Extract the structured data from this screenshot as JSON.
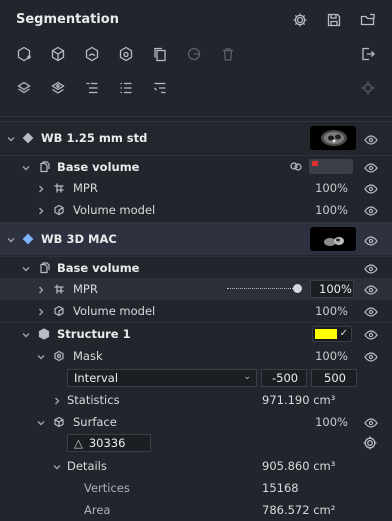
{
  "panel": {
    "title": "Segmentation"
  },
  "colors": {
    "structure_color": "#ffff00",
    "selected_row_bg": "#2d3140",
    "red_marker": "#e03030"
  },
  "header_icons": [
    "gear-icon",
    "save-icon",
    "open-folder-icon"
  ],
  "toolbar": {
    "row1": [
      "add-shape-icon",
      "cube-icon",
      "cube-cut-icon",
      "cube-gear-icon",
      "copy-icon",
      "undo-circle-icon",
      "trash-icon",
      "export-icon"
    ],
    "row2": [
      "layers-stack-icon",
      "layers-alt-icon",
      "indent-list-icon",
      "list-icon",
      "outdent-list-icon",
      "target-icon"
    ]
  },
  "tree": {
    "series1": {
      "label": "WB 1.25 mm std"
    },
    "bv1": {
      "label": "Base volume"
    },
    "mpr1": {
      "label": "MPR",
      "pct": "100%"
    },
    "vm1": {
      "label": "Volume model",
      "pct": "100%"
    },
    "series2": {
      "label": "WB 3D MAC"
    },
    "bv2": {
      "label": "Base volume"
    },
    "mpr2": {
      "label": "MPR",
      "pct": "100%"
    },
    "vm2": {
      "label": "Volume model",
      "pct": "100%"
    },
    "structure": {
      "label": "Structure 1"
    },
    "mask": {
      "label": "Mask",
      "pct": "100%"
    },
    "interval": {
      "mode": "Interval",
      "min": "-500",
      "max": "500"
    },
    "statistics": {
      "label": "Statistics",
      "value": "971.190 cm³"
    },
    "surface": {
      "label": "Surface",
      "pct": "100%",
      "triangles": "30336"
    },
    "details": {
      "label": "Details",
      "value": "905.860 cm³"
    },
    "vertices": {
      "label": "Vertices",
      "value": "15168"
    },
    "area": {
      "label": "Area",
      "value": "786.572 cm²"
    }
  }
}
